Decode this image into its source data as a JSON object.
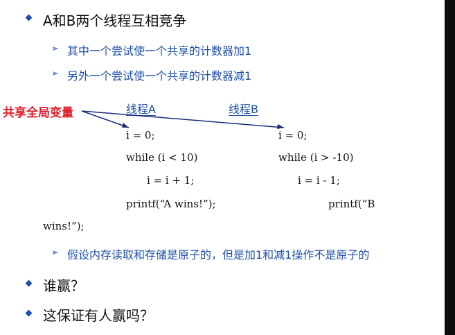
{
  "bullets": {
    "b1": "A和B两个线程互相竞争",
    "b2": "谁赢？",
    "b3": "这保证有人赢吗？"
  },
  "sub_bullets": {
    "s1": "其中一个尝试使一个共享的计数器加1",
    "s2": "另外一个尝试使一个共享的计数器减1",
    "s3": "假设内存读取和存储是原子的，但是加1和减1操作不是原子的"
  },
  "shared_label": "共享全局变量",
  "thread_a": {
    "title": "线程A",
    "init": "i = 0;",
    "loop": "while (i < 10)",
    "body": "i = i + 1;",
    "print": "printf(“A wins!”);"
  },
  "thread_b": {
    "title": "线程B",
    "init": "i = 0;",
    "loop": "while (i > -10)",
    "body": "i = i  - 1;",
    "print_start": "printf(“B",
    "print_end": "wins!”);"
  },
  "colors": {
    "bullet_blue": "#1f4fa8",
    "label_red": "#e0202a",
    "text": "#111111"
  }
}
